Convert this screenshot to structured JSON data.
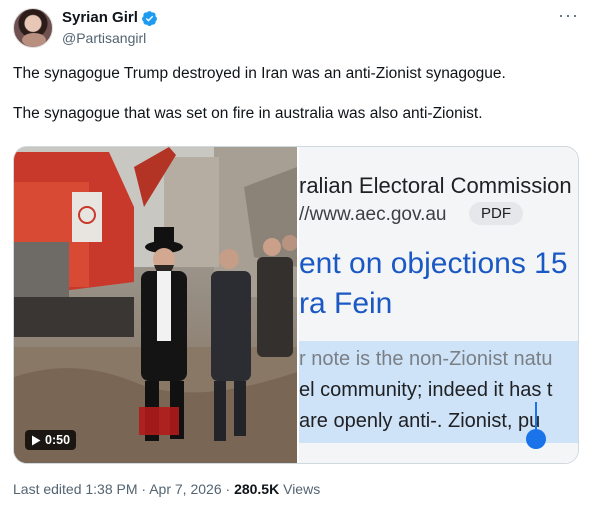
{
  "author": {
    "display_name": "Syrian Girl",
    "handle": "@Partisangirl"
  },
  "more_label": "···",
  "tweet": {
    "paragraph_1": "The synagogue Trump destroyed in Iran was an anti-Zionist synagogue.",
    "paragraph_2": "The synagogue that was set on fire in australia was also anti-Zionist."
  },
  "media": {
    "video_duration": "0:50",
    "screenshot": {
      "title": "ralian Electoral Commission",
      "url": "//www.aec.gov.au",
      "badge": "PDF",
      "heading_1": "ent on objections 15",
      "heading_2": "ra Fein",
      "body_line_1": "r note is the non-Zionist natu",
      "body_line_2": "el community; indeed it has t",
      "body_line_3": "are openly anti-. Zionist, pu"
    }
  },
  "footer": {
    "last_edited": "Last edited 1:38 PM",
    "date": "Apr 7, 2026",
    "views_count": "280.5K",
    "views_label": "Views",
    "separator": "·"
  },
  "colors": {
    "verified_badge": "#1d9bf0",
    "link_blue": "#1a59c4",
    "highlight": "#cfe3f8",
    "muted_text": "#536471"
  }
}
